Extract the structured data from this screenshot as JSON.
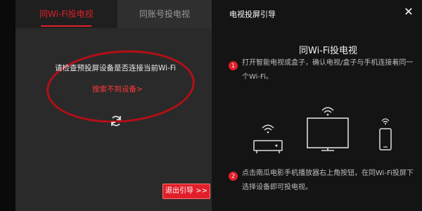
{
  "left_panel": {
    "tabs": [
      {
        "label": "同Wi-Fi投电视"
      },
      {
        "label": "同账号投电视"
      }
    ],
    "prompt": "请检查预投屏设备是否连接当前Wi-Fi",
    "link": "搜索不到设备>",
    "exit_button": "退出引导 >>"
  },
  "right_panel": {
    "title": "电视投屏引导",
    "heading": "同Wi-Fi投电视",
    "steps": [
      {
        "num": "1",
        "text": "打开智能电视或盒子，确认电视/盒子与手机连接着同一个Wi-Fi。"
      },
      {
        "num": "2",
        "text": "点击南瓜电影手机播放器右上角按钮，在同Wi-Fi投屏下选择设备即可投电视。"
      }
    ]
  },
  "icons": [
    "refresh-icon",
    "close-icon",
    "wifi-icon",
    "set-top-box-icon",
    "tv-icon",
    "phone-icon"
  ],
  "colors": {
    "accent": "#e11f2a",
    "panel": "#2a2a2a",
    "right_panel": "#141414"
  }
}
